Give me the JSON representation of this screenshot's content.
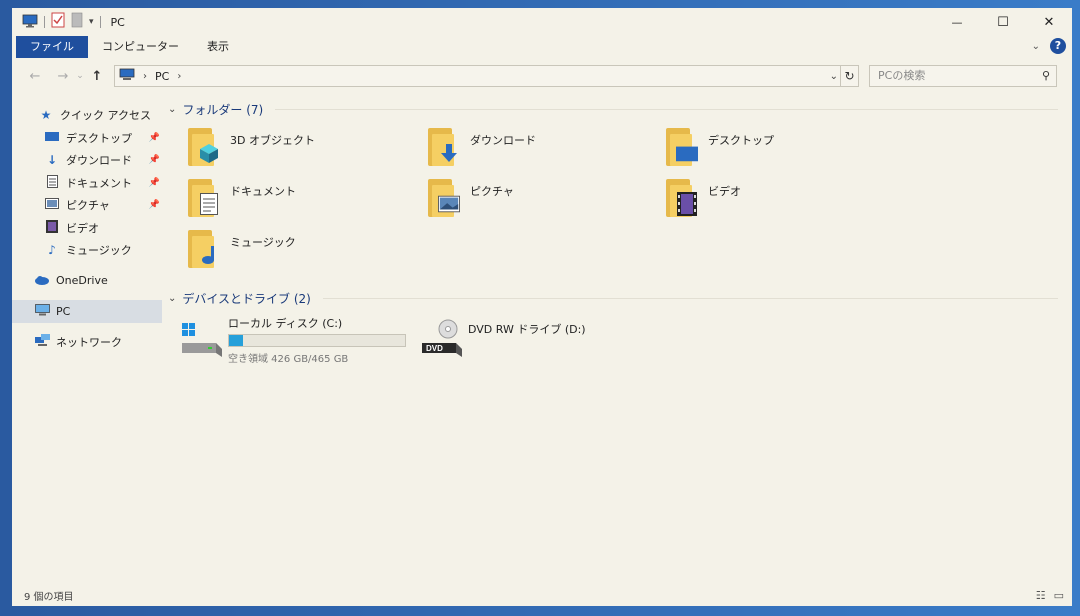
{
  "title": "PC",
  "window_controls": {
    "minimize": "—",
    "maximize": "☐",
    "close": "✕"
  },
  "ribbon_tabs": [
    "ファイル",
    "コンピューター",
    "表示"
  ],
  "address": {
    "location_icon": "computer-icon",
    "crumb": "PC"
  },
  "search": {
    "placeholder": "PCの検索"
  },
  "sidebar": [
    {
      "label": "クイック アクセス",
      "icon": "star-icon",
      "pinned": false
    },
    {
      "label": "デスクトップ",
      "icon": "desktop-icon",
      "pinned": true
    },
    {
      "label": "ダウンロード",
      "icon": "download-icon",
      "pinned": true
    },
    {
      "label": "ドキュメント",
      "icon": "document-icon",
      "pinned": true
    },
    {
      "label": "ピクチャ",
      "icon": "picture-icon",
      "pinned": true
    },
    {
      "label": "ビデオ",
      "icon": "video-icon",
      "pinned": false
    },
    {
      "label": "ミュージック",
      "icon": "music-icon",
      "pinned": false
    },
    {
      "label": "OneDrive",
      "icon": "cloud-icon",
      "pinned": false
    },
    {
      "label": "PC",
      "icon": "computer-icon",
      "pinned": false,
      "selected": true
    },
    {
      "label": "ネットワーク",
      "icon": "network-icon",
      "pinned": false
    }
  ],
  "folders_header": "フォルダー (7)",
  "folders": [
    {
      "name": "3D オブジェクト",
      "icon": "3d-objects-icon"
    },
    {
      "name": "ダウンロード",
      "icon": "download-folder-icon"
    },
    {
      "name": "デスクトップ",
      "icon": "desktop-folder-icon"
    },
    {
      "name": "ドキュメント",
      "icon": "documents-folder-icon"
    },
    {
      "name": "ピクチャ",
      "icon": "pictures-folder-icon"
    },
    {
      "name": "ビデオ",
      "icon": "videos-folder-icon"
    },
    {
      "name": "ミュージック",
      "icon": "music-folder-icon"
    }
  ],
  "devices_header": "デバイスとドライブ (2)",
  "drives": [
    {
      "name": "ローカル ディスク (C:)",
      "icon": "hard-drive-icon",
      "free_text": "空き領域 426 GB/465 GB",
      "used_fraction": 0.08
    },
    {
      "name": "DVD RW ドライブ (D:)",
      "icon": "dvd-drive-icon",
      "dvd_label": "DVD"
    }
  ],
  "status": {
    "item_count": "9 個の項目"
  },
  "colors": {
    "accent": "#1f4f9e",
    "folder": "#f5cf63",
    "progress": "#26a0da",
    "window_bg": "#f4f2e8"
  }
}
